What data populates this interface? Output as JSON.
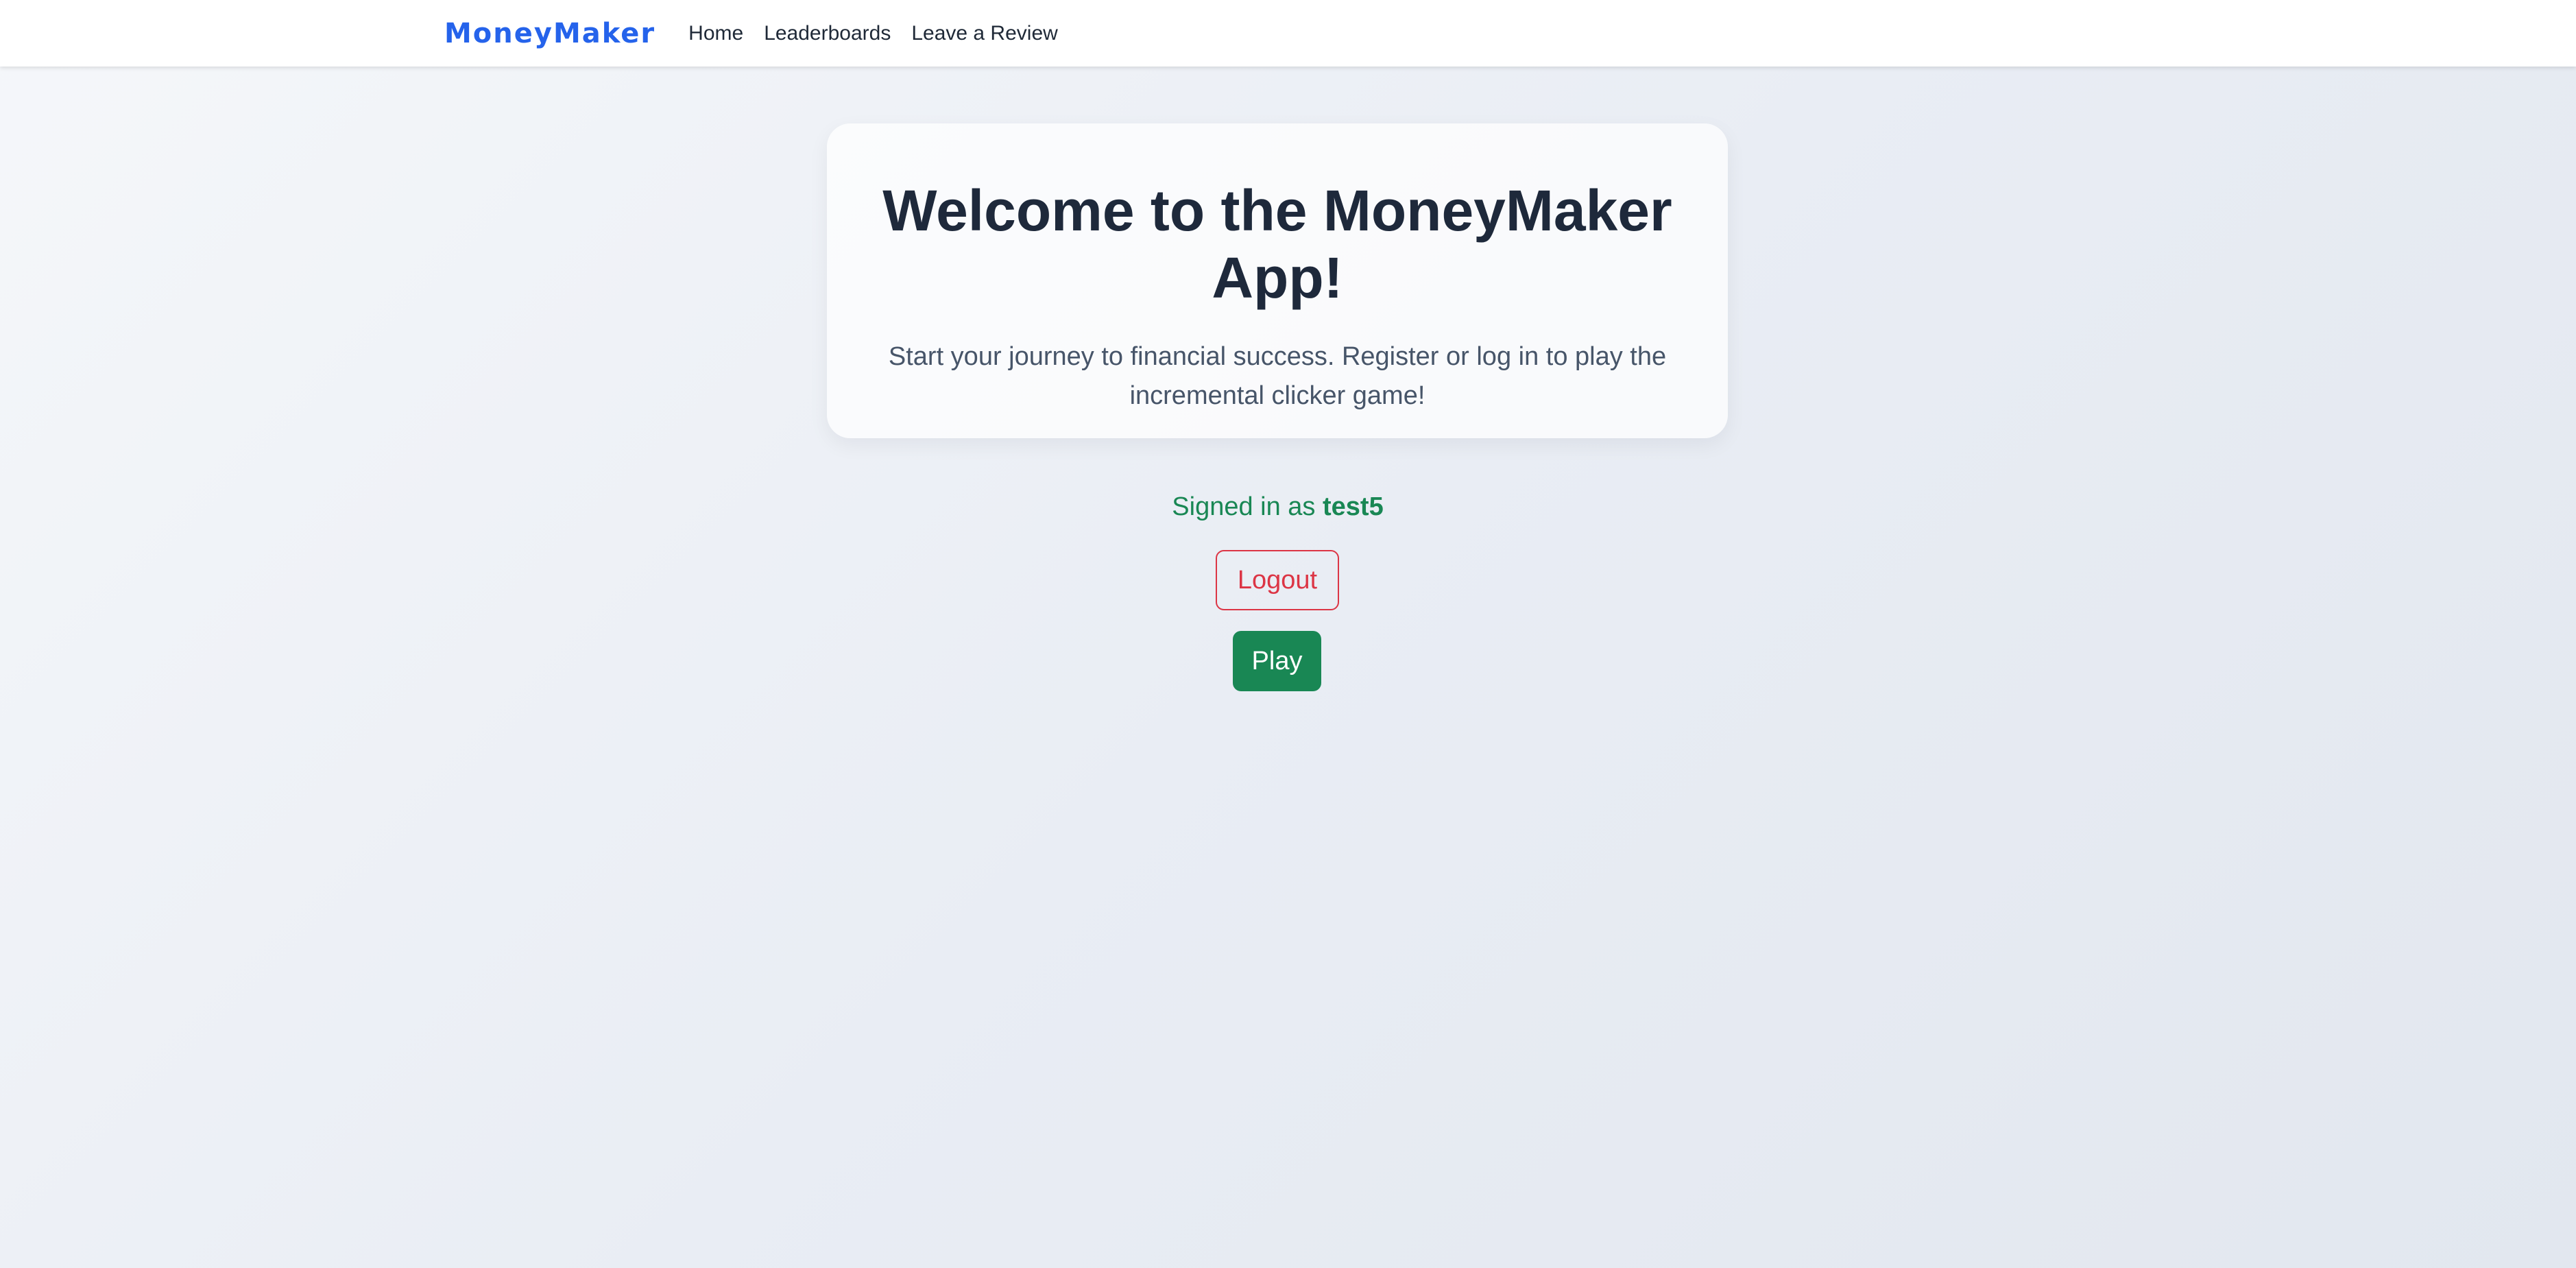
{
  "navbar": {
    "brand": "MoneyMaker",
    "links": [
      {
        "label": "Home"
      },
      {
        "label": "Leaderboards"
      },
      {
        "label": "Leave a Review"
      }
    ]
  },
  "hero": {
    "title": "Welcome to the MoneyMaker App!",
    "subtitle": "Start your journey to financial success. Register or log in to play the incremental clicker game!"
  },
  "auth": {
    "signed_in_prefix": "Signed in as",
    "username": "test5",
    "logout_label": "Logout",
    "play_label": "Play"
  },
  "colors": {
    "brand": "#2563eb",
    "success": "#198754",
    "danger": "#dc3545",
    "title": "#1e293b"
  }
}
